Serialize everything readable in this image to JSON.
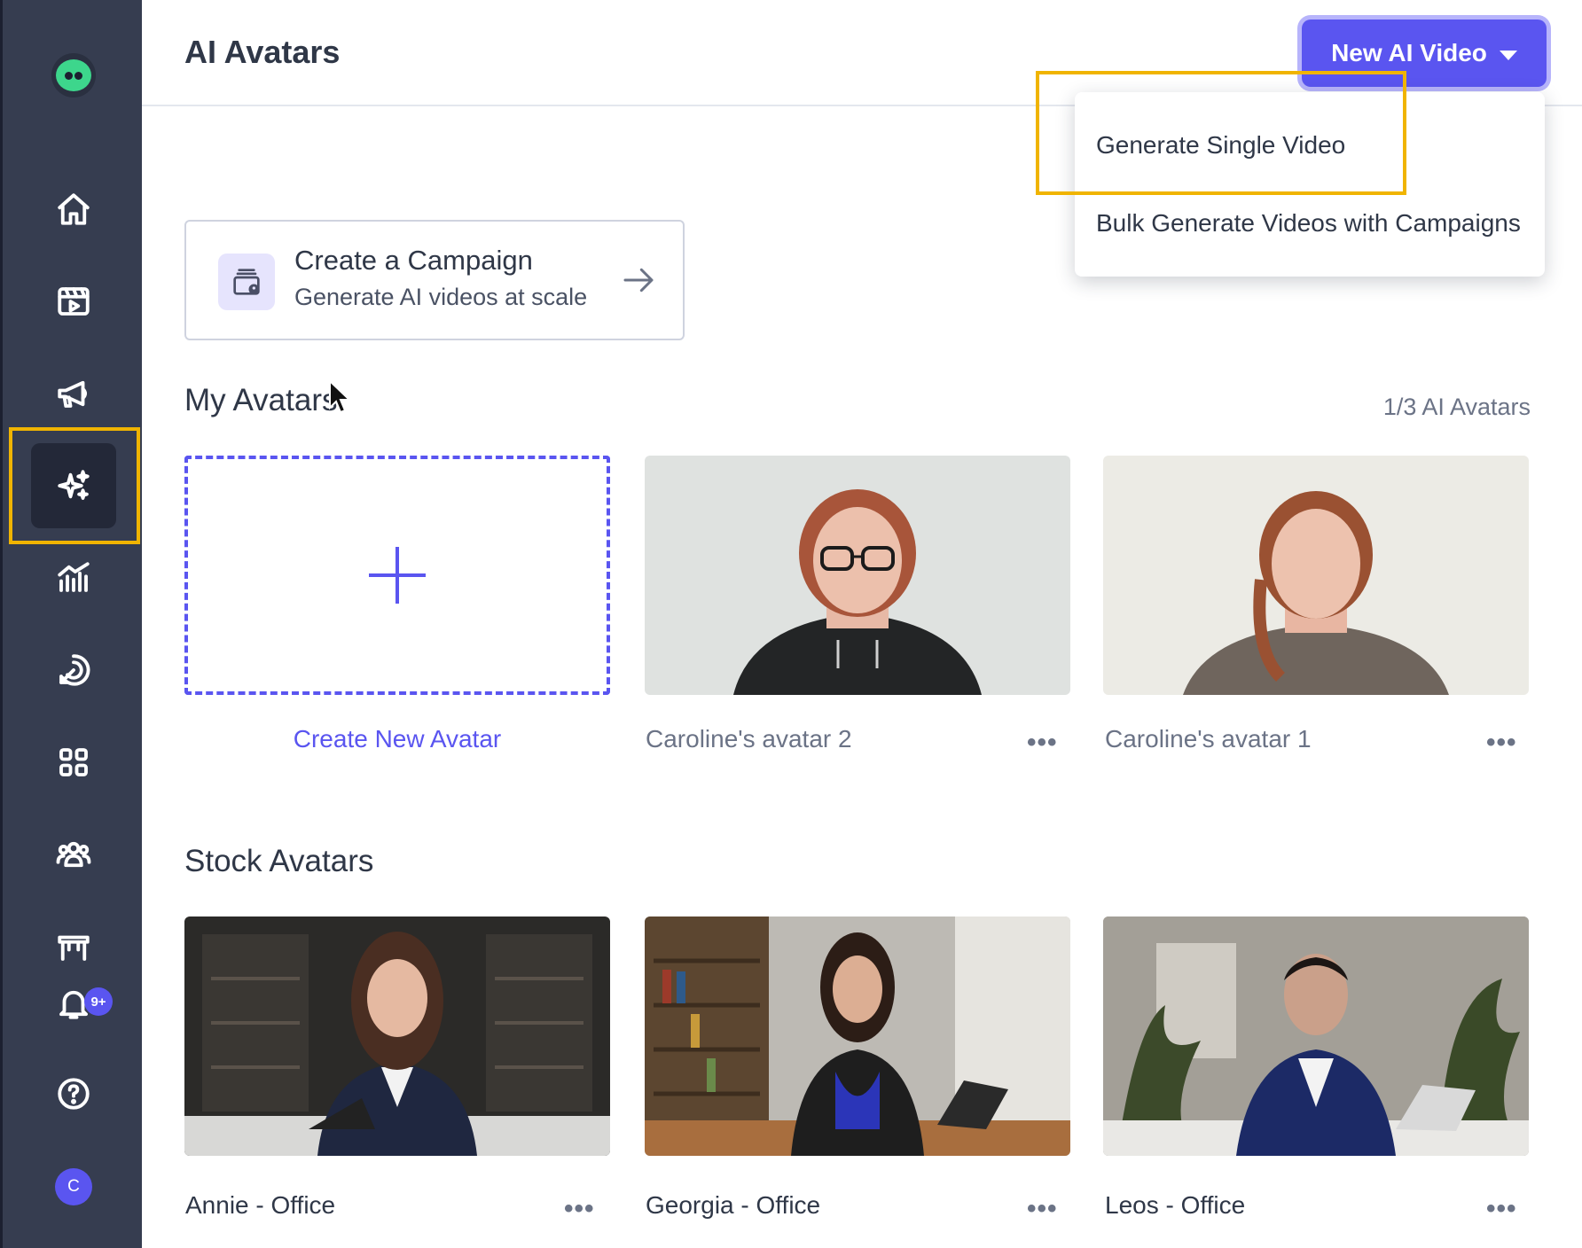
{
  "header": {
    "title": "AI Avatars",
    "new_video_button": "New AI Video"
  },
  "dropdown": {
    "items": [
      "Generate Single Video",
      "Bulk Generate Videos with Campaigns"
    ]
  },
  "campaign_card": {
    "title": "Create a Campaign",
    "subtitle": "Generate AI videos at scale"
  },
  "my_avatars": {
    "title": "My Avatars",
    "count": "1/3 AI Avatars",
    "create_label": "Create New Avatar",
    "items": [
      {
        "name": "Caroline's avatar 2"
      },
      {
        "name": "Caroline's avatar 1"
      }
    ]
  },
  "stock_avatars": {
    "title": "Stock Avatars",
    "items": [
      {
        "name": "Annie - Office"
      },
      {
        "name": "Georgia - Office"
      },
      {
        "name": "Leos - Office"
      }
    ]
  },
  "sidebar": {
    "items": [
      {
        "icon": "home-icon"
      },
      {
        "icon": "video-library-icon"
      },
      {
        "icon": "megaphone-icon"
      },
      {
        "icon": "sparkles-icon",
        "active": true
      },
      {
        "icon": "analytics-icon"
      },
      {
        "icon": "target-icon"
      },
      {
        "icon": "apps-grid-icon"
      },
      {
        "icon": "team-icon"
      },
      {
        "icon": "storefront-icon"
      },
      {
        "icon": "bell-icon"
      },
      {
        "icon": "help-icon"
      }
    ],
    "notification_badge": "9+",
    "user_initial": "C"
  },
  "colors": {
    "accent": "#5a55f0",
    "sidebar_bg": "#363d50",
    "highlight": "#f0b400"
  }
}
